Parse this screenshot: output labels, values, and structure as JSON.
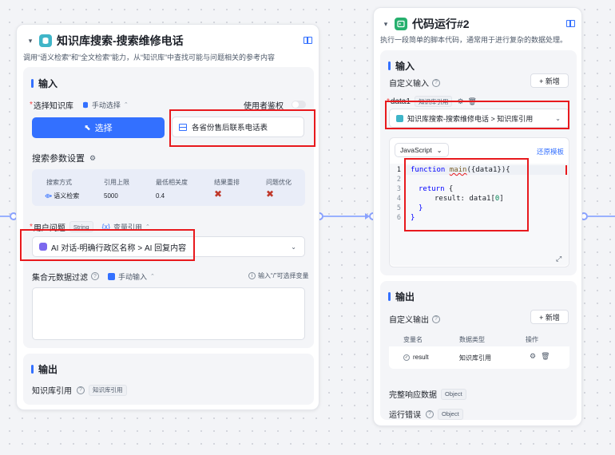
{
  "node1": {
    "title": "知识库搜索-搜索维修电话",
    "desc": "调用“语义检索”和“全文检索”能力，从“知识库”中查找可能与问题相关的参考内容",
    "input_section": "输入",
    "kb_label": "选择知识库",
    "kb_mode": "手动选择",
    "auth_label": "使用者鉴权",
    "select_btn": "选择",
    "selected_kb": "各省份售后联系电话表",
    "search_params": "搜索参数设置",
    "params_table": {
      "headers": [
        "搜索方式",
        "引用上限",
        "最低相关度",
        "结果重排",
        "问题优化"
      ],
      "values": [
        "语义检索",
        "5000",
        "0.4"
      ]
    },
    "user_question_label": "用户问题",
    "user_question_type": "String",
    "var_ref": "变量引用",
    "question_value": "AI 对话-明确行政区名称 > AI 回复内容",
    "filter_label": "集合元数据过滤",
    "filter_mode": "手动输入",
    "filter_hint": "输入“/”可选择变量",
    "output_section": "输出",
    "kb_ref_label": "知识库引用",
    "kb_ref_tag": "知识库引用"
  },
  "node2": {
    "title": "代码运行#2",
    "desc": "执行一段简单的脚本代码，通常用于进行复杂的数据处理。",
    "input_section": "输入",
    "custom_input": "自定义输入",
    "add_btn": "+ 新增",
    "data1_label": "data1",
    "data1_tag": "知识库引用",
    "data1_value": "知识库搜索-搜索维修电话 > 知识库引用",
    "lang": "JavaScript",
    "restore": "还原模板",
    "code": {
      "line_numbers": [
        "1",
        "2",
        "3",
        "4",
        "5",
        "6"
      ],
      "l1_kw": "function",
      "l1_fn": "main",
      "l1_rest": "({data1}){",
      "l3_kw": "return",
      "l3_rest": " {",
      "l4_key": "result: data1[",
      "l4_num": "0",
      "l4_end": "]",
      "l5": "}",
      "l6": "}"
    },
    "output_section": "输出",
    "custom_output": "自定义输出",
    "out_add_btn": "+ 新增",
    "out_table": {
      "headers": [
        "变量名",
        "数据类型",
        "操作"
      ],
      "var": "result",
      "type": "知识库引用"
    },
    "full_resp": "完整响应数据",
    "full_resp_tag": "Object",
    "run_error": "运行错误",
    "run_error_tag": "Object"
  },
  "colors": {
    "accent": "#3370ff",
    "highlight": "#e8191d",
    "wire": "#8aa2ff"
  }
}
